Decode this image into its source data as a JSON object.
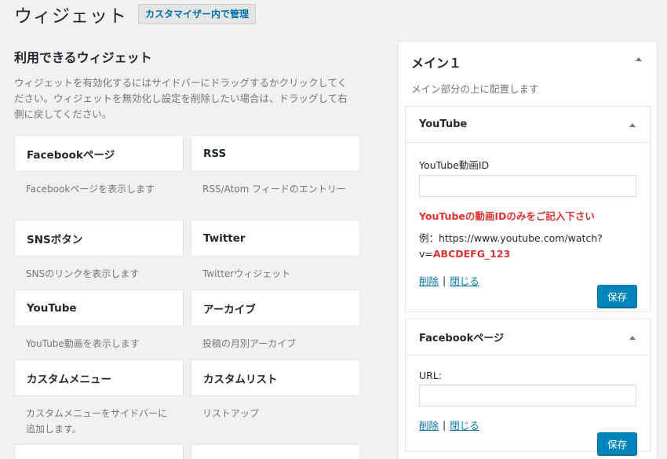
{
  "header": {
    "title": "ウィジェット",
    "customizer_button": "カスタマイザー内で管理"
  },
  "available": {
    "title": "利用できるウィジェット",
    "description": "ウィジェットを有効化するにはサイドバーにドラッグするかクリックしてください。ウィジェットを無効化し設定を削除したい場合は、ドラッグして右側に戻してください。",
    "widgets": [
      {
        "title": "Facebookページ",
        "desc": "Facebookページを表示します"
      },
      {
        "title": "RSS",
        "desc": "RSS/Atom フィードのエントリー"
      },
      {
        "title": "SNSボタン",
        "desc": "SNSのリンクを表示します"
      },
      {
        "title": "Twitter",
        "desc": "Twitterウィジェット"
      },
      {
        "title": "YouTube",
        "desc": "YouTube動画を表示します"
      },
      {
        "title": "アーカイブ",
        "desc": "投稿の月別アーカイブ"
      },
      {
        "title": "カスタムメニュー",
        "desc": "カスタムメニューをサイドバーに追加します。"
      },
      {
        "title": "カスタムリスト",
        "desc": "リストアップ"
      }
    ]
  },
  "sidebar": {
    "title": "メイン１",
    "description": "メイン部分の上に配置します",
    "youtube_panel": {
      "title": "YouTube",
      "field_label": "YouTube動画ID",
      "field_value": "",
      "notice": "YouTubeの動画IDのみをご記入下さい",
      "example_prefix": "例：https://www.youtube.com/watch?v=",
      "example_id": "ABCDEFG_123",
      "delete_label": "削除",
      "separator": "|",
      "close_label": "閉じる",
      "save_label": "保存"
    },
    "facebook_panel": {
      "title": "Facebookページ",
      "field_label": "URL:",
      "field_value": "",
      "delete_label": "削除",
      "separator": "|",
      "close_label": "閉じる",
      "save_label": "保存"
    }
  },
  "colors": {
    "accent": "#0073aa",
    "primary_button": "#0085ba",
    "notice_red": "#dc3232"
  }
}
